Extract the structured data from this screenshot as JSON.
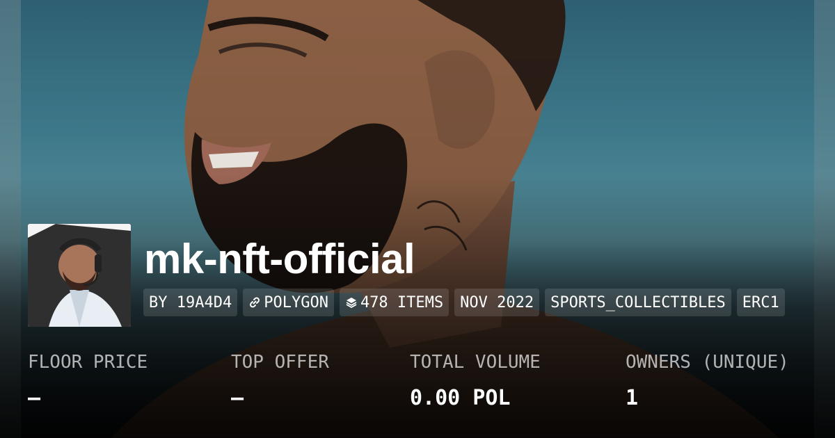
{
  "collection": {
    "name": "mk-nft-official"
  },
  "chips": [
    {
      "label": "BY 19A4D4",
      "icon": ""
    },
    {
      "label": "POLYGON",
      "icon": "link-icon"
    },
    {
      "label": "478 ITEMS",
      "icon": "layers-icon"
    },
    {
      "label": "NOV 2022",
      "icon": ""
    },
    {
      "label": "SPORTS_COLLECTIBLES",
      "icon": ""
    },
    {
      "label": "ERC1",
      "icon": ""
    }
  ],
  "stats": [
    {
      "label": "FLOOR PRICE",
      "value": "–"
    },
    {
      "label": "TOP OFFER",
      "value": "–"
    },
    {
      "label": "TOTAL VOLUME",
      "value": "0.00 POL"
    },
    {
      "label": "OWNERS (UNIQUE)",
      "value": "1"
    }
  ],
  "colors": {
    "banner_top": "#2e5f72",
    "banner_mid": "#5e98a6",
    "text": "#ffffff",
    "chip_bg": "rgba(255,255,255,0.13)"
  }
}
